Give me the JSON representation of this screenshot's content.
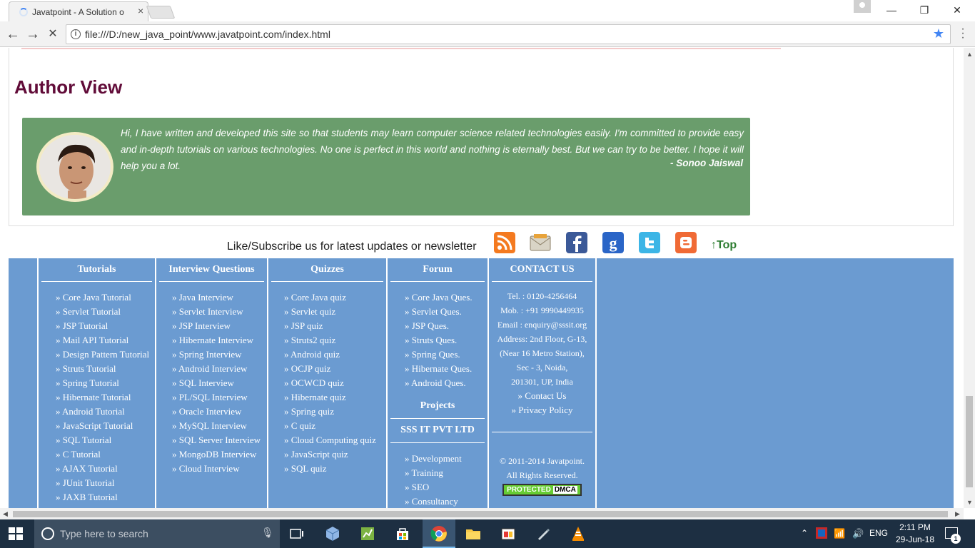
{
  "browser": {
    "tab_title": "Javatpoint - A Solution o",
    "tab_close": "×",
    "url": "file:///D:/new_java_point/www.javatpoint.com/index.html",
    "window_controls": {
      "minimize": "—",
      "maximize": "❐",
      "close": "✕"
    },
    "nav": {
      "back": "←",
      "forward": "→",
      "stop": "✕"
    }
  },
  "author": {
    "heading": "Author View",
    "quote": "Hi, I have written and developed this site so that students may learn computer science related technologies easily. I'm committed to provide easy and in-depth tutorials on various technologies. No one is perfect in this world and nothing is eternally best. But we can try to be better. I hope it will help you a lot.",
    "signature": "- Sonoo Jaiswal"
  },
  "subscribe": {
    "text": "Like/Subscribe us for latest updates or newsletter",
    "top_link": "↑Top",
    "icons": [
      "rss-icon",
      "email-icon",
      "facebook-icon",
      "google-icon",
      "twitter-icon",
      "blogger-icon"
    ]
  },
  "footer": {
    "tutorials": {
      "heading": "Tutorials",
      "items": [
        "» Core Java Tutorial",
        "» Servlet Tutorial",
        "» JSP Tutorial",
        "» Mail API Tutorial",
        "» Design Pattern Tutorial",
        "» Struts Tutorial",
        "» Spring Tutorial",
        "» Hibernate Tutorial",
        "» Android Tutorial",
        "» JavaScript Tutorial",
        "» SQL Tutorial",
        "» C Tutorial",
        "» AJAX Tutorial",
        "» JUnit Tutorial",
        "» JAXB Tutorial"
      ]
    },
    "interview": {
      "heading": "Interview Questions",
      "items": [
        "» Java Interview",
        "» Servlet Interview",
        "» JSP Interview",
        "» Hibernate Interview",
        "» Spring Interview",
        "» Android Interview",
        "» SQL Interview",
        "» PL/SQL Interview",
        "» Oracle Interview",
        "» MySQL Interview",
        "» SQL Server Interview",
        "» MongoDB Interview",
        "» Cloud Interview"
      ]
    },
    "quizzes": {
      "heading": "Quizzes",
      "items": [
        "» Core Java quiz",
        "» Servlet quiz",
        "» JSP quiz",
        "» Struts2 quiz",
        "» Android quiz",
        "» OCJP quiz",
        "» OCWCD quiz",
        "» Hibernate quiz",
        "» Spring quiz",
        "» C quiz",
        "» Cloud Computing quiz",
        "» JavaScript quiz",
        "» SQL quiz"
      ]
    },
    "forum": {
      "heading": "Forum",
      "items": [
        "» Core Java Ques.",
        "» Servlet Ques.",
        "» JSP Ques.",
        "» Struts Ques.",
        "» Spring Ques.",
        "» Hibernate Ques.",
        "» Android Ques."
      ],
      "projects_heading": "Projects",
      "company_heading": "SSS IT PVT LTD",
      "company_items": [
        "» Development",
        "» Training",
        "» SEO",
        "» Consultancy"
      ]
    },
    "contact": {
      "heading": "CONTACT US",
      "lines": [
        "Tel. : 0120-4256464",
        "Mob. : +91 9990449935",
        "Email : enquiry@sssit.org",
        "Address: 2nd Floor, G-13,",
        "(Near 16 Metro Station),",
        "Sec - 3, Noida,",
        "201301, UP, India"
      ],
      "links": [
        "» Contact Us",
        "» Privacy Policy"
      ],
      "copyright": "© 2011-2014 Javatpoint.",
      "rights": "All Rights Reserved.",
      "dmca_left": "PROTECTED",
      "dmca_right": "DMCA"
    }
  },
  "taskbar": {
    "search_placeholder": "Type here to search",
    "language": "ENG",
    "time": "2:11 PM",
    "date": "29-Jun-18",
    "notification_count": "1"
  }
}
